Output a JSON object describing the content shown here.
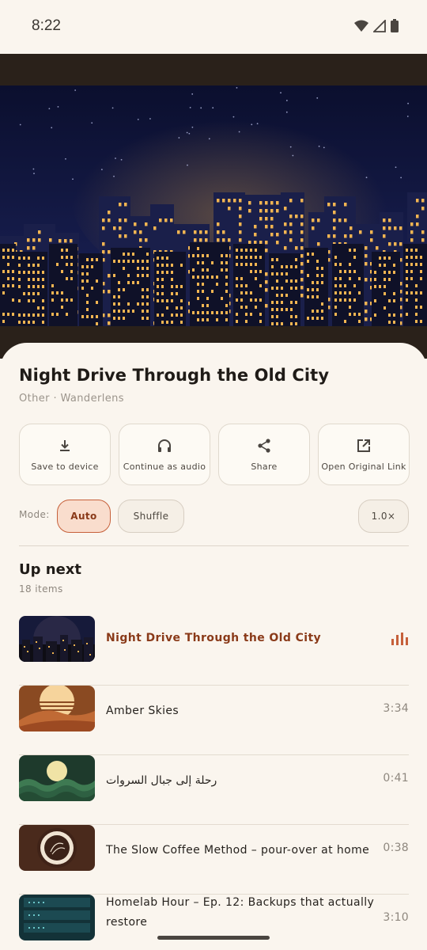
{
  "status_bar": {
    "time": "8:22"
  },
  "video": {
    "title": "Night Drive Through the Old City",
    "meta": "Other · Wanderlens"
  },
  "actions": [
    {
      "label": "Save to device",
      "icon": "download-icon"
    },
    {
      "label": "Continue as audio",
      "icon": "headphones-icon"
    },
    {
      "label": "Share",
      "icon": "share-icon"
    },
    {
      "label": "Open Original Link",
      "icon": "open-external-icon"
    }
  ],
  "mode": {
    "label": "Mode:",
    "auto": "Auto",
    "shuffle": "Shuffle",
    "speed": "1.0×",
    "selected": "Auto"
  },
  "up_next": {
    "title": "Up next",
    "count": "18 items",
    "items": [
      {
        "title": "Night Drive Through the Old City",
        "duration": "",
        "playing": true
      },
      {
        "title": "Amber Skies",
        "duration": "3:34"
      },
      {
        "title": "رحلة إلى جبال السروات",
        "duration": "0:41"
      },
      {
        "title": "The Slow Coffee Method – pour-over at home",
        "duration": "0:38"
      },
      {
        "title": "Homelab Hour – Ep. 12: Backups that actually restore",
        "duration": "3:10"
      }
    ]
  },
  "colors": {
    "accent": "#c6603a",
    "accent_text": "#8a3a19",
    "background": "#faf5ee",
    "window_light": "#f2b552"
  }
}
